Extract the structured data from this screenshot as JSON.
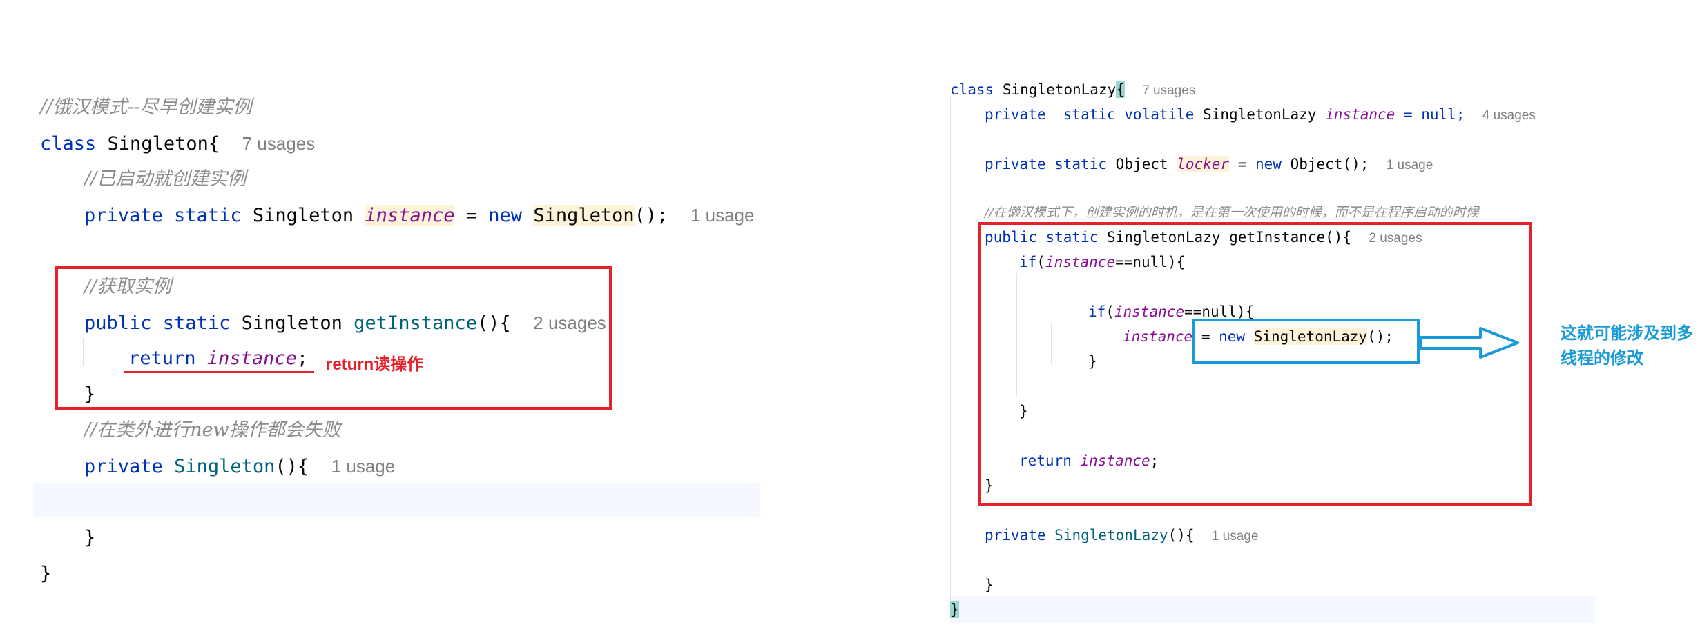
{
  "left": {
    "comment_title": "//饿汉模式--尽早创建实例",
    "class_kw": "class",
    "class_name": "Singleton",
    "class_brace": "{",
    "class_usages": "7 usages",
    "comment_startup": "//已启动就创建实例",
    "field_kw": "private static",
    "field_type": "Singleton",
    "field_name": "instance",
    "field_eq": "=",
    "new_kw": "new",
    "ctor_call": "Singleton",
    "ctor_tail": "();",
    "field_usages": "1 usage",
    "comment_get": "//获取实例",
    "method_kw": "public static",
    "method_type": "Singleton",
    "method_name": "getInstance",
    "method_tail": "(){",
    "method_usages": "2 usages",
    "return_kw": "return",
    "return_var": "instance",
    "return_semi": ";",
    "annotation": "return读操作",
    "close_brace": "}",
    "comment_outside": "//在类外进行new操作都会失败",
    "private_kw": "private",
    "ctor_name": "Singleton",
    "ctor_sig_tail": "(){",
    "ctor_usages": "1 usage",
    "ctor_close": "}",
    "class_close": "}"
  },
  "right": {
    "class_kw": "class",
    "class_name": "SingletonLazy",
    "class_brace": "{",
    "class_usages": "7 usages",
    "f1_kw": "private  static volatile",
    "f1_type": "SingletonLazy",
    "f1_name": "instance",
    "f1_init": "= null;",
    "f1_usages": "4 usages",
    "f2_kw": "private static",
    "f2_type": "Object",
    "f2_name": "locker",
    "f2_eq": "=",
    "f2_new": "new",
    "f2_init": "Object();",
    "f2_usages": "1 usage",
    "comment_lazy": "//在懒汉模式下，创建实例的时机，是在第一次使用的时候，而不是在程序启动的时候",
    "m_kw": "public static",
    "m_type": "SingletonLazy",
    "m_name": "getInstance",
    "m_tail": "(){",
    "m_usages": "2 usages",
    "if1_kw": "if",
    "if1_open": "(",
    "if1_var": "instance",
    "if1_tail": "==null){",
    "if2_kw": "if",
    "if2_open": "(",
    "if2_var": "instance",
    "if2_tail": "==null){",
    "assign_var": "instance",
    "assign_eq": "=",
    "assign_new": "new",
    "assign_ctor": "SingletonLazy",
    "assign_tail": "();",
    "brace": "}",
    "return_kw": "return",
    "return_var": "instance",
    "return_semi": ";",
    "ctor_kw": "private",
    "ctor_name": "SingletonLazy",
    "ctor_tail": "(){",
    "ctor_usages": "1 usage",
    "annotation_line1": "这就可能涉及到多",
    "annotation_line2": "线程的修改"
  },
  "colors": {
    "keyword": "#0033b3",
    "method": "#00627a",
    "field": "#871094",
    "comment": "#8c8c8c",
    "usage_hint": "#808080",
    "red_annotation": "#e5222a",
    "blue_annotation": "#1a9ad6"
  }
}
